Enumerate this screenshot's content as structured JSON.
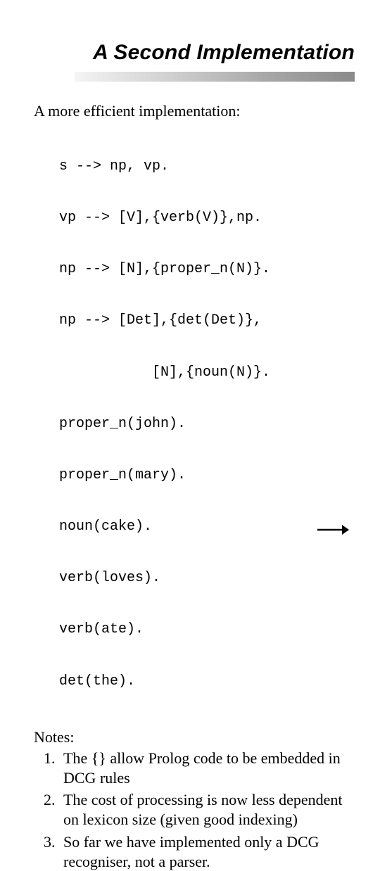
{
  "title": "A Second Implementation",
  "intro": "A more efficient implementation:",
  "code_lines": [
    "s --> np, vp.",
    "vp --> [V],{verb(V)},np.",
    "np --> [N],{proper_n(N)}.",
    "np --> [Det],{det(Det)},",
    "           [N],{noun(N)}.",
    "proper_n(john).",
    "proper_n(mary).",
    "noun(cake).",
    "verb(loves).",
    "verb(ate).",
    "det(the)."
  ],
  "notes_label": "Notes:",
  "notes": [
    "The {} allow Prolog code to be embedded in DCG rules",
    "The cost of processing is now less dependent on lexicon size (given good indexing)",
    "So far we have implemented only a DCG recogniser, not a parser."
  ]
}
